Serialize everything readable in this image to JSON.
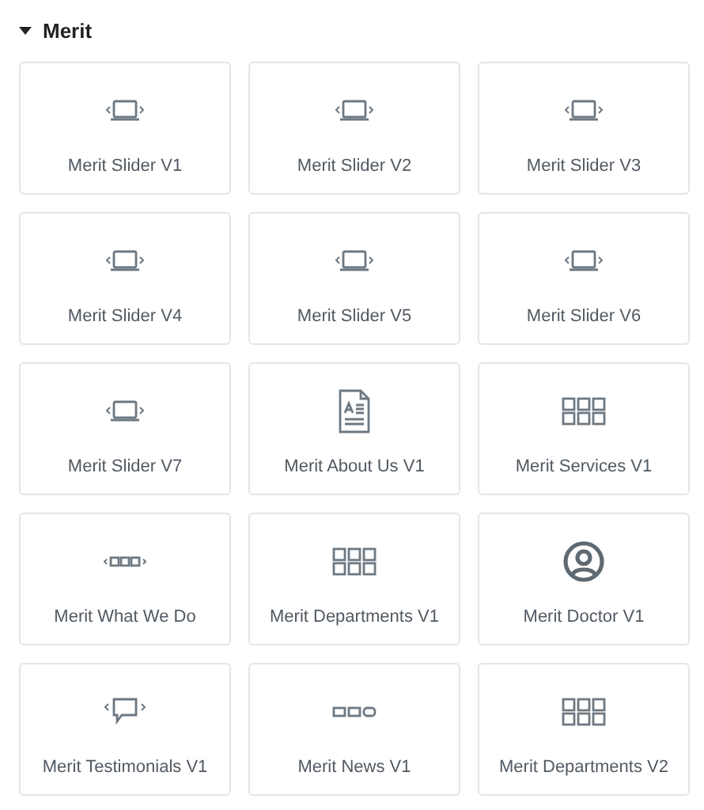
{
  "section": {
    "title": "Merit",
    "expanded": true,
    "widgets": [
      {
        "label": "Merit Slider V1",
        "kind": "slider"
      },
      {
        "label": "Merit Slider V2",
        "kind": "slider"
      },
      {
        "label": "Merit Slider V3",
        "kind": "slider"
      },
      {
        "label": "Merit Slider V4",
        "kind": "slider"
      },
      {
        "label": "Merit Slider V5",
        "kind": "slider"
      },
      {
        "label": "Merit Slider V6",
        "kind": "slider"
      },
      {
        "label": "Merit Slider V7",
        "kind": "slider"
      },
      {
        "label": "Merit About Us V1",
        "kind": "document"
      },
      {
        "label": "Merit Services V1",
        "kind": "grid"
      },
      {
        "label": "Merit What We Do",
        "kind": "carousel"
      },
      {
        "label": "Merit Departments V1",
        "kind": "grid"
      },
      {
        "label": "Merit Doctor V1",
        "kind": "person"
      },
      {
        "label": "Merit Testimonials V1",
        "kind": "testimonial"
      },
      {
        "label": "Merit News V1",
        "kind": "boxes"
      },
      {
        "label": "Merit Departments V2",
        "kind": "grid"
      }
    ]
  }
}
